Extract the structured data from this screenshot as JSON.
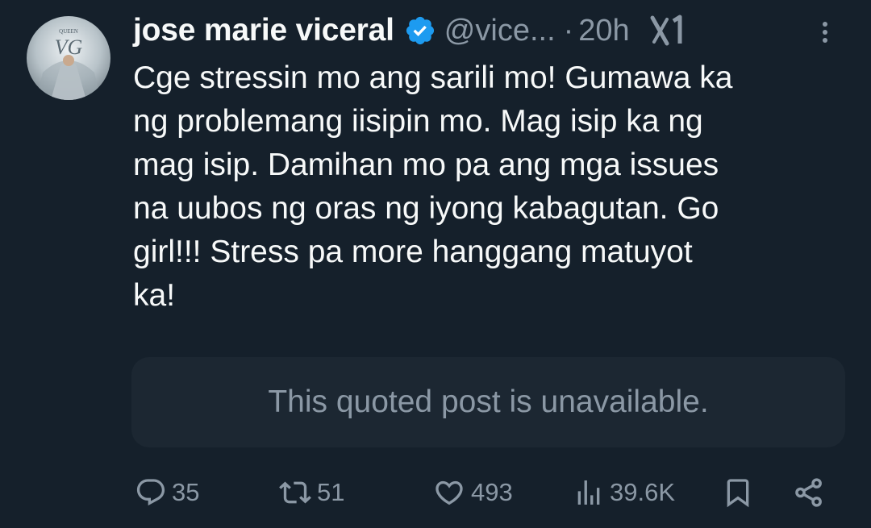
{
  "author": {
    "name": "jose marie viceral",
    "handle": "@vice...",
    "separator": "·",
    "time": "20h",
    "avatar_text": "VG",
    "avatar_caption": "QUEEN"
  },
  "tweet_text": "Cge stressin mo ang sarili mo! Gumawa ka\nng problemang iisipin mo. Mag isip ka ng\nmag isip. Damihan mo pa ang mga issues\nna uubos ng oras  ng iyong kabagutan. Go\ngirl!!! Stress pa more hanggang matuyot\nka!",
  "quoted_post": {
    "message": "This quoted post is unavailable."
  },
  "actions": {
    "replies": "35",
    "reposts": "51",
    "likes": "493",
    "views": "39.6K"
  },
  "colors": {
    "background": "#15202b",
    "text_primary": "#f7f9f9",
    "text_secondary": "#8b98a5",
    "verified_badge": "#1d9bf0",
    "quote_box": "#1c2732"
  },
  "icons": {
    "verified": "verified-badge-icon",
    "grok": "grok-icon",
    "more": "more-options-icon",
    "reply": "reply-icon",
    "repost": "repost-icon",
    "like": "like-icon",
    "views": "views-icon",
    "bookmark": "bookmark-icon",
    "share": "share-icon"
  }
}
